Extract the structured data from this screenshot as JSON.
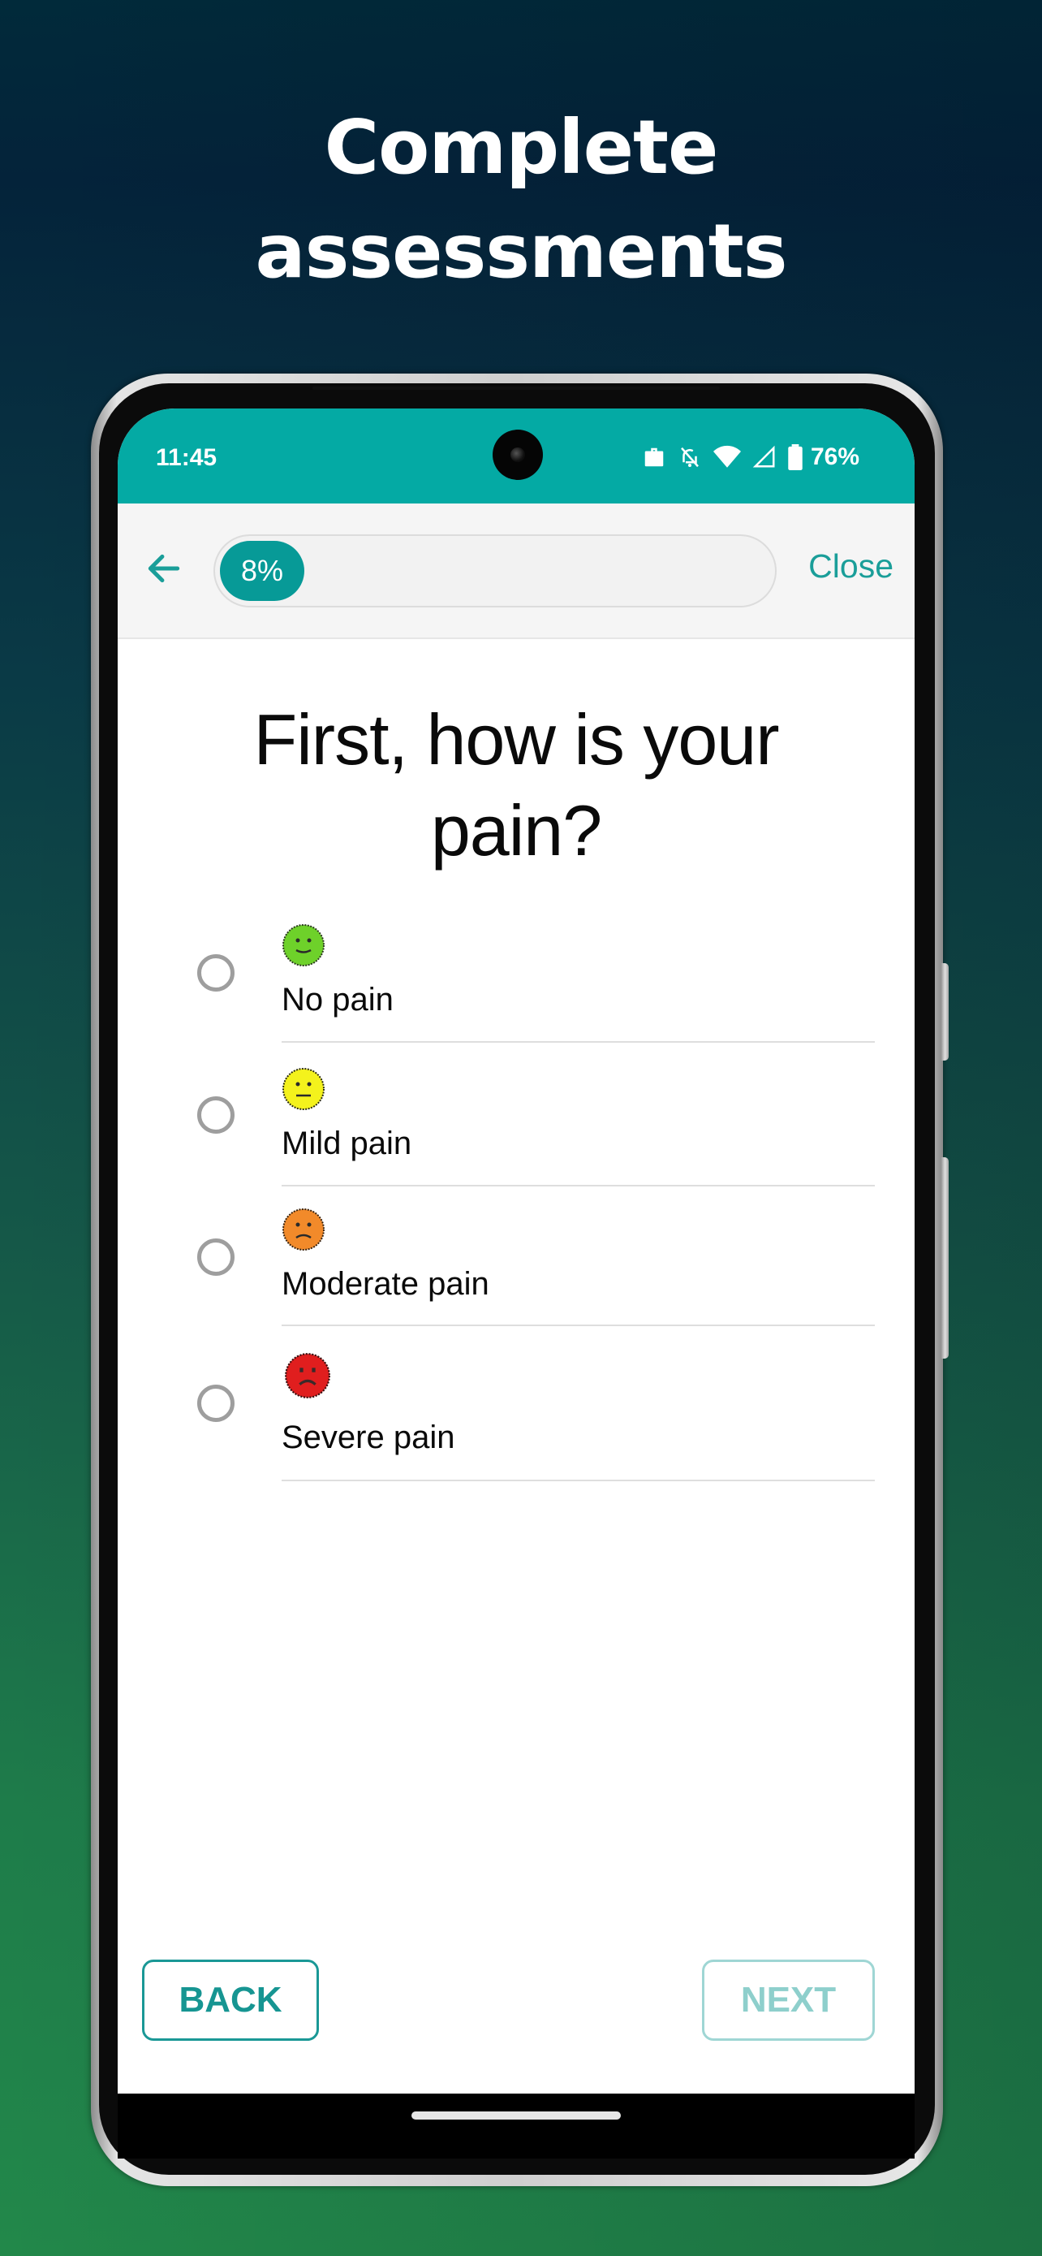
{
  "promo": {
    "headline_line1": "Complete",
    "headline_line2": "assessments"
  },
  "status_bar": {
    "time": "11:45",
    "icons": [
      "work-profile-icon",
      "notifications-off-icon",
      "wifi-icon",
      "cell-signal-icon",
      "battery-icon"
    ],
    "battery": "76%"
  },
  "header": {
    "back_icon": "arrow-left-icon",
    "progress_percent": 8,
    "progress_label": "8%",
    "close_label": "Close"
  },
  "question": {
    "title": "First, how is your pain?"
  },
  "options": [
    {
      "label": "No pain",
      "icon": "smiley-happy-icon",
      "face_color": "#6ed12a",
      "selected": false
    },
    {
      "label": "Mild pain",
      "icon": "smiley-neutral-icon",
      "face_color": "#f4f21c",
      "selected": false
    },
    {
      "label": "Moderate pain",
      "icon": "smiley-sad-icon",
      "face_color": "#f28a2a",
      "selected": false
    },
    {
      "label": "Severe pain",
      "icon": "smiley-crying-icon",
      "face_color": "#e01e1e",
      "selected": false
    }
  ],
  "footer": {
    "back_label": "BACK",
    "next_label": "NEXT",
    "next_enabled": false
  },
  "colors": {
    "accent": "#04aaa4",
    "accent_dark": "#079a97",
    "button_disabled": "#8ecfcc"
  }
}
